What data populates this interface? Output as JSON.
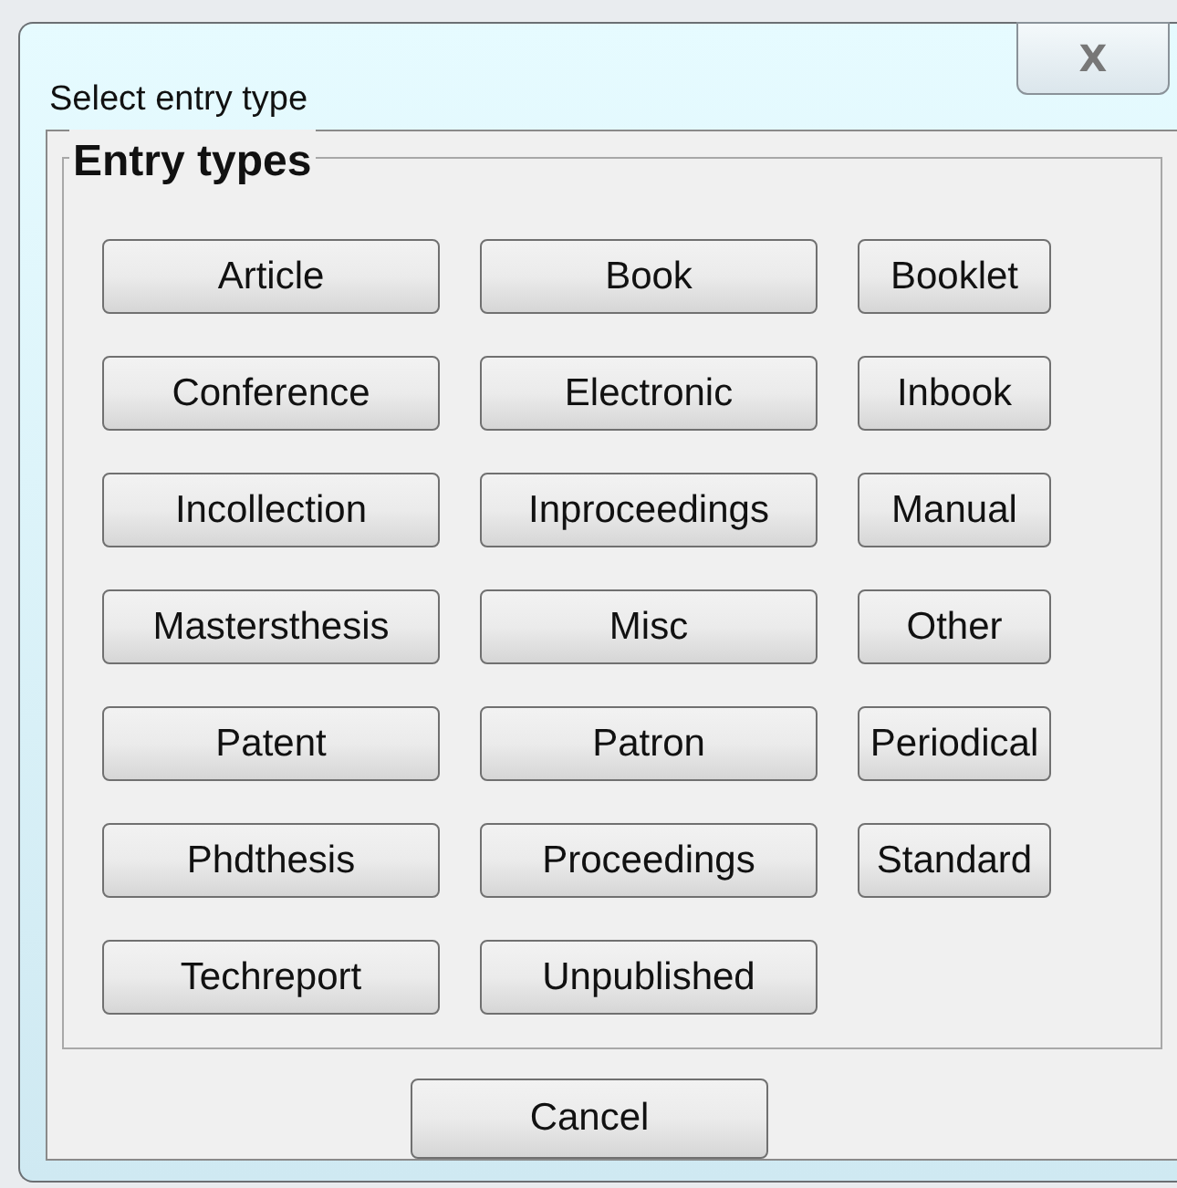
{
  "window": {
    "title": "Select entry type",
    "close_label": "X"
  },
  "group": {
    "title": "Entry types"
  },
  "entry_types": [
    "Article",
    "Book",
    "Booklet",
    "Conference",
    "Electronic",
    "Inbook",
    "Incollection",
    "Inproceedings",
    "Manual",
    "Mastersthesis",
    "Misc",
    "Other",
    "Patent",
    "Patron",
    "Periodical",
    "Phdthesis",
    "Proceedings",
    "Standard",
    "Techreport",
    "Unpublished"
  ],
  "buttons": [
    "Cancel"
  ]
}
